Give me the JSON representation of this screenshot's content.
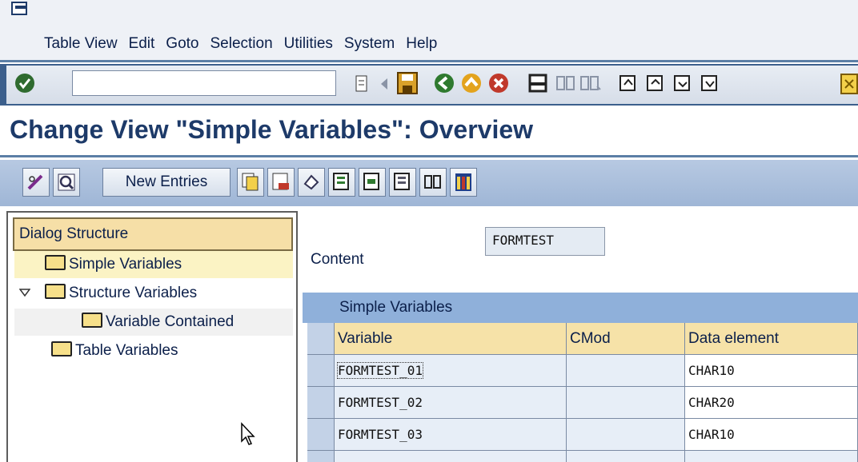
{
  "menu": {
    "items": [
      "Table View",
      "Edit",
      "Goto",
      "Selection",
      "Utilities",
      "System",
      "Help"
    ]
  },
  "page": {
    "title": "Change View \"Simple Variables\": Overview"
  },
  "app_toolbar": {
    "new_entries_label": "New Entries"
  },
  "dialog_structure": {
    "header": "Dialog Structure",
    "nodes": [
      {
        "label": "Simple Variables",
        "level": 1,
        "selected": true
      },
      {
        "label": "Structure Variables",
        "level": 1,
        "expanded": true
      },
      {
        "label": "Variable Contained",
        "level": 2
      },
      {
        "label": "Table Variables",
        "level": 1
      }
    ]
  },
  "content": {
    "label": "Content",
    "value": "FORMTEST"
  },
  "table": {
    "title": "Simple Variables",
    "columns": [
      "Variable",
      "CMod",
      "Data element"
    ],
    "rows": [
      [
        "FORMTEST_01",
        "",
        "CHAR10"
      ],
      [
        "FORMTEST_02",
        "",
        "CHAR20"
      ],
      [
        "FORMTEST_03",
        "",
        "CHAR10"
      ]
    ]
  },
  "colors": {
    "accent": "#3c5f8c",
    "title": "#1d3a69",
    "header_bg": "#f6e2a8"
  }
}
